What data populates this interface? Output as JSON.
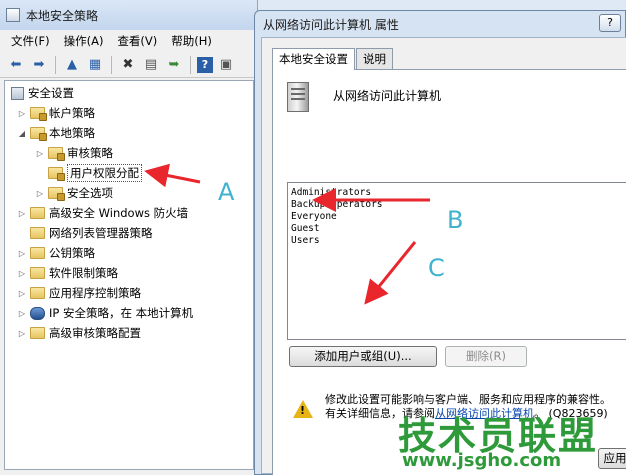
{
  "main_window": {
    "title": "本地安全策略",
    "menu": [
      "文件(F)",
      "操作(A)",
      "查看(V)",
      "帮助(H)"
    ],
    "tree": [
      {
        "label": "安全设置",
        "expanded": true
      },
      {
        "label": "帐户策略"
      },
      {
        "label": "本地策略",
        "expanded": true
      },
      {
        "label": "审核策略"
      },
      {
        "label": "用户权限分配",
        "selected": true
      },
      {
        "label": "安全选项"
      },
      {
        "label": "高级安全 Windows 防火墙"
      },
      {
        "label": "网络列表管理器策略"
      },
      {
        "label": "公钥策略"
      },
      {
        "label": "软件限制策略"
      },
      {
        "label": "应用程序控制策略"
      },
      {
        "label": "IP 安全策略，在 本地计算机"
      },
      {
        "label": "高级审核策略配置"
      }
    ]
  },
  "dialog": {
    "title": "从网络访问此计算机 属性",
    "help_button": "?",
    "tabs": [
      "本地安全设置",
      "说明"
    ],
    "policy_name": "从网络访问此计算机",
    "accounts": [
      "Administrators",
      "Backup Operators",
      "Everyone",
      "Guest",
      "Users"
    ],
    "add_button": "添加用户或组(U)...",
    "remove_button": "删除(R)",
    "warning_line1": "修改此设置可能影响与客户端、服务和应用程序的兼容性。",
    "warning_line2_prefix": "有关详细信息，请参阅",
    "warning_link": "从网络访问此计算机",
    "warning_line2_suffix": "。 (Q823659)",
    "apply_button": "应用"
  },
  "annotations": {
    "a": "A",
    "b": "B",
    "c": "C"
  },
  "watermark": {
    "title": "技术员联盟",
    "url": "www.jsgho.com"
  },
  "colors": {
    "annotation_arrow": "#e8262b",
    "annotation_letter": "#3fb2cf",
    "watermark": "#2e9a3a"
  }
}
